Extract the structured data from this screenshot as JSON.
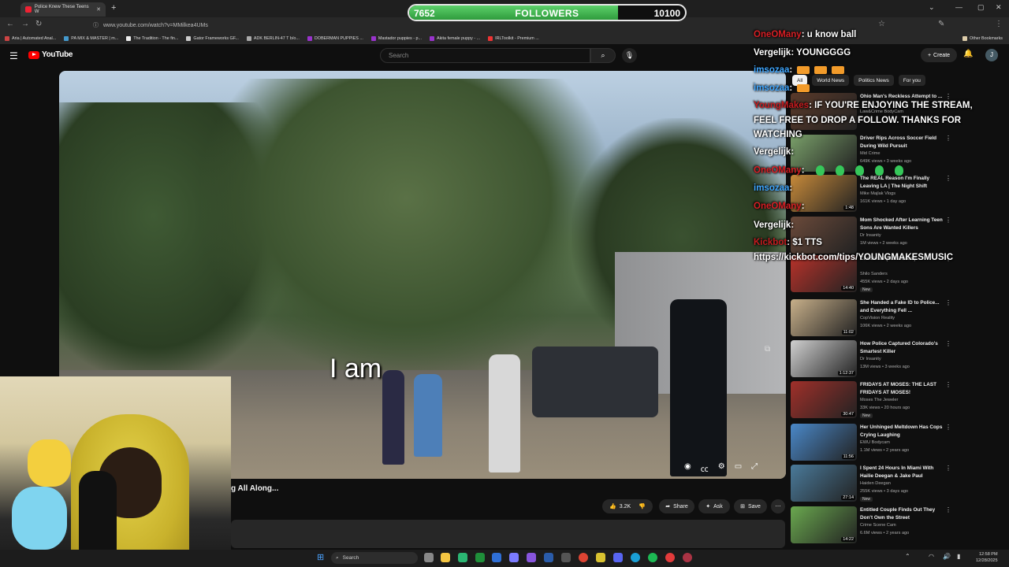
{
  "browser": {
    "tab_title": "Police Knew These Teens W",
    "url": "www.youtube.com/watch?v=MMilkea4UMs",
    "bookmarks": [
      "Aria | Automated Anal...",
      "PA MIX & MASTER | m...",
      "The Tradition - The fin...",
      "Gator Frameworks GF...",
      "ADK BERLIN-47 T b/o...",
      "DOBERMAN PUPPIES ...",
      "Mastador puppies - p...",
      "Akita female puppy - ...",
      "IRLToolkit - Premium ..."
    ],
    "other_bookmarks": "Other Bookmarks"
  },
  "youtube": {
    "logo": "YouTube",
    "search_placeholder": "Search",
    "create_label": "Create",
    "avatar_initial": "J",
    "video_caption": "I am",
    "video_title": "g All Along...",
    "likes": "3.2K",
    "share_label": "Share",
    "ask_label": "Ask",
    "save_label": "Save",
    "chips": [
      "All",
      "World News",
      "Politics News",
      "For you"
    ],
    "recommendations": [
      {
        "title": "Ohio Man's Reckless Attempt to ...",
        "channel": "Law&Crime BodyCam",
        "meta": "",
        "duration": "",
        "new": ""
      },
      {
        "title": "Driver Rips Across Soccer Field During Wild Pursuit",
        "channel": "Mid Crime",
        "meta": "649K views • 3 weeks ago",
        "duration": "",
        "new": ""
      },
      {
        "title": "The REAL Reason I'm Finally Leaving LA | The Night Shift",
        "channel": "Mike Majlak Vlogs",
        "meta": "161K views • 1 day ago",
        "duration": "1:48",
        "new": ""
      },
      {
        "title": "Mom Shocked After Learning Teen Sons Are Wanted Killers",
        "channel": "Dr Insanity",
        "meta": "1M views • 2 weeks ago",
        "duration": "",
        "new": ""
      },
      {
        "title": "Christmas (Gift Reveal)",
        "channel": "Shilo Sanders",
        "meta": "455K views • 2 days ago",
        "duration": "14:40",
        "new": "New"
      },
      {
        "title": "She Handed a Fake ID to Police... and Everything Fell ...",
        "channel": "CopVision Reality",
        "meta": "106K views • 2 weeks ago",
        "duration": "11:02",
        "new": ""
      },
      {
        "title": "How Police Captured Colorado's Smartest Killer",
        "channel": "Dr Insanity",
        "meta": "13M views • 3 weeks ago",
        "duration": "1:12:37",
        "new": ""
      },
      {
        "title": "FRIDAYS AT MOSES: THE LAST FRIDAYS AT MOSES!",
        "channel": "Moses The Jeweler",
        "meta": "33K views • 20 hours ago",
        "duration": "30:47",
        "new": "New"
      },
      {
        "title": "Her Unhinged Meltdown Has Cops Crying Laughing",
        "channel": "EWU Bodycam",
        "meta": "1.1M views • 2 years ago",
        "duration": "11:56",
        "new": ""
      },
      {
        "title": "I Spent 24 Hours In Miami With Hailie Deegan & Jake Paul",
        "channel": "Haiden Deegan",
        "meta": "255K views • 3 days ago",
        "duration": "27:14",
        "new": "New"
      },
      {
        "title": "Entitled Couple Finds Out They Don't Own the Street",
        "channel": "Crime Scene Cam",
        "meta": "6.6M views • 2 years ago",
        "duration": "14:22",
        "new": ""
      }
    ]
  },
  "overlay": {
    "followers_current": "7652",
    "followers_label": "FOLLOWERS",
    "followers_goal": "10100",
    "followers_progress": 0.758,
    "chat": [
      {
        "user": "OneOMany",
        "message": ": u know ball",
        "color": "#d81e24"
      },
      {
        "user": "Vergelijk",
        "message": ": YOUNGGGG",
        "color": "#ffffff"
      },
      {
        "user": "imsozaa",
        "message": ":",
        "color": "#3ea6ff"
      },
      {
        "user": "imsozaa",
        "message": ":",
        "color": "#3ea6ff"
      },
      {
        "user": "YoungMakes",
        "message": ": IF YOU'RE ENJOYING THE STREAM,",
        "color": "#c61b1f"
      },
      {
        "user": "",
        "message": "FEEL FREE TO DROP A FOLLOW. THANKS FOR",
        "color": "#ffffff"
      },
      {
        "user": "",
        "message": "WATCHING",
        "color": "#ffffff"
      },
      {
        "user": "Vergelijk",
        "message": ":",
        "color": "#ffffff"
      },
      {
        "user": "OneOMany",
        "message": ":",
        "color": "#d81e24"
      },
      {
        "user": "imsozaa",
        "message": ":",
        "color": "#3ea6ff"
      },
      {
        "user": "OneOMany",
        "message": ":",
        "color": "#d81e24"
      },
      {
        "user": "Vergelijk",
        "message": ":",
        "color": "#ffffff"
      },
      {
        "user": "Kickbot",
        "message": ": $1 TTS",
        "color": "#c61b1f"
      },
      {
        "user": "",
        "message": "https://kickbot.com/tips/YOUNGMAKESMUSIC",
        "color": "#ffffff"
      }
    ]
  },
  "taskbar": {
    "search_label": "Search",
    "time": "12:58 PM",
    "date": "12/28/2025"
  }
}
